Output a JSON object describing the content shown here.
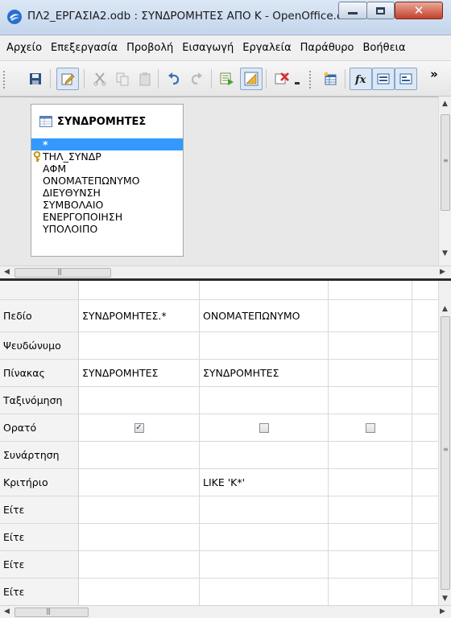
{
  "window": {
    "title": "ΠΛ2_ΕΡΓΑΣΙΑ2.odb : ΣΥΝΔΡΟΜΗΤΕΣ ΑΠΟ Κ - OpenOffice.o..."
  },
  "menu": [
    "Αρχείο",
    "Επεξεργασία",
    "Προβολή",
    "Εισαγωγή",
    "Εργαλεία",
    "Παράθυρο",
    "Βοήθεια"
  ],
  "toolbar": {
    "icons": [
      "save-icon",
      "edit-mode-icon",
      "cut-icon",
      "copy-icon",
      "paste-icon",
      "undo-icon",
      "redo-icon",
      "run-query-icon",
      "design-view-icon",
      "clear-query-icon",
      "add-table-icon",
      "functions-icon",
      "table-names-icon",
      "alias-icon"
    ],
    "overflow": "»"
  },
  "design": {
    "table_name": "ΣΥΝΔΡΟΜΗΤΕΣ",
    "fields": [
      "*",
      "ΤΗΛ_ΣΥΝΔΡ",
      "ΑΦΜ",
      "ΟΝΟΜΑΤΕΠΩΝΥΜΟ",
      "ΔΙΕΥΘΥΝΣΗ",
      "ΣΥΜΒΟΛΑΙΟ",
      "ΕΝΕΡΓΟΠΟΙΗΣΗ",
      "ΥΠΟΛΟΙΠΟ"
    ],
    "selected_field": "*",
    "primary_key_field": "ΤΗΛ_ΣΥΝΔΡ"
  },
  "grid": {
    "row_labels": [
      "Πεδίο",
      "Ψευδώνυμο",
      "Πίνακας",
      "Ταξινόμηση",
      "Ορατό",
      "Συνάρτηση",
      "Κριτήριο",
      "Είτε",
      "Είτε",
      "Είτε",
      "Είτε"
    ],
    "columns": [
      {
        "field": "ΣΥΝΔΡΟΜΗΤΕΣ.*",
        "alias": "",
        "table": "ΣΥΝΔΡΟΜΗΤΕΣ",
        "sort": "",
        "visible": true,
        "function": "",
        "criterion": ""
      },
      {
        "field": "ΟΝΟΜΑΤΕΠΩΝΥΜΟ",
        "alias": "",
        "table": "ΣΥΝΔΡΟΜΗΤΕΣ",
        "sort": "",
        "visible": false,
        "function": "",
        "criterion": "LIKE 'K*'"
      },
      {
        "field": "",
        "alias": "",
        "table": "",
        "sort": "",
        "visible": false,
        "function": "",
        "criterion": ""
      }
    ]
  }
}
